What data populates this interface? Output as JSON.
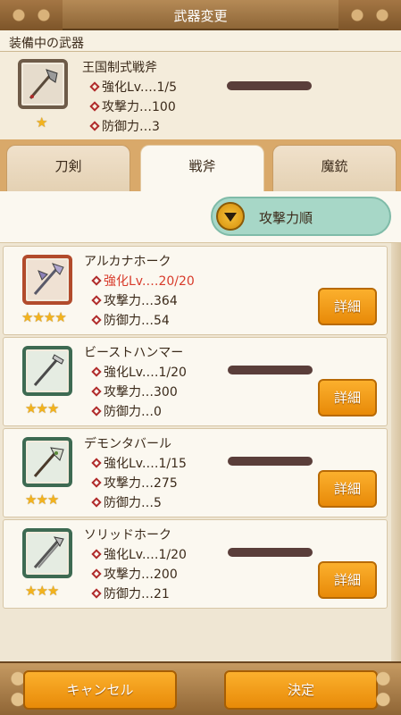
{
  "header": {
    "title": "武器変更"
  },
  "equipped": {
    "section_label": "装備中の武器",
    "weapon": {
      "name": "王国制式戦斧",
      "stars": "★",
      "enhance": "強化Lv.…1/5",
      "attack": "攻撃力…100",
      "defense": "防御力…3"
    }
  },
  "tabs": [
    {
      "label": "刀剣"
    },
    {
      "label": "戦斧",
      "active": true
    },
    {
      "label": "魔銃"
    }
  ],
  "sort": {
    "label": "攻撃力順",
    "icon": "chevron-down-icon"
  },
  "weapons": [
    {
      "name": "アルカナホーク",
      "stars": "★★★★",
      "enhance": "強化Lv.…20/20",
      "attack": "攻撃力…364",
      "defense": "防御力…54",
      "detail": "詳細",
      "maxed": true
    },
    {
      "name": "ビーストハンマー",
      "stars": "★★★",
      "enhance": "強化Lv.…1/20",
      "attack": "攻撃力…300",
      "defense": "防御力…0",
      "detail": "詳細"
    },
    {
      "name": "デモンタバール",
      "stars": "★★★",
      "enhance": "強化Lv.…1/15",
      "attack": "攻撃力…275",
      "defense": "防御力…5",
      "detail": "詳細"
    },
    {
      "name": "ソリッドホーク",
      "stars": "★★★",
      "enhance": "強化Lv.…1/20",
      "attack": "攻撃力…200",
      "defense": "防御力…21",
      "detail": "詳細"
    }
  ],
  "footer": {
    "cancel": "キャンセル",
    "confirm": "決定"
  },
  "colors": {
    "accent": "#f39c12",
    "sort_bg": "#a7d7c7",
    "maxed_text": "#d83b2b"
  }
}
